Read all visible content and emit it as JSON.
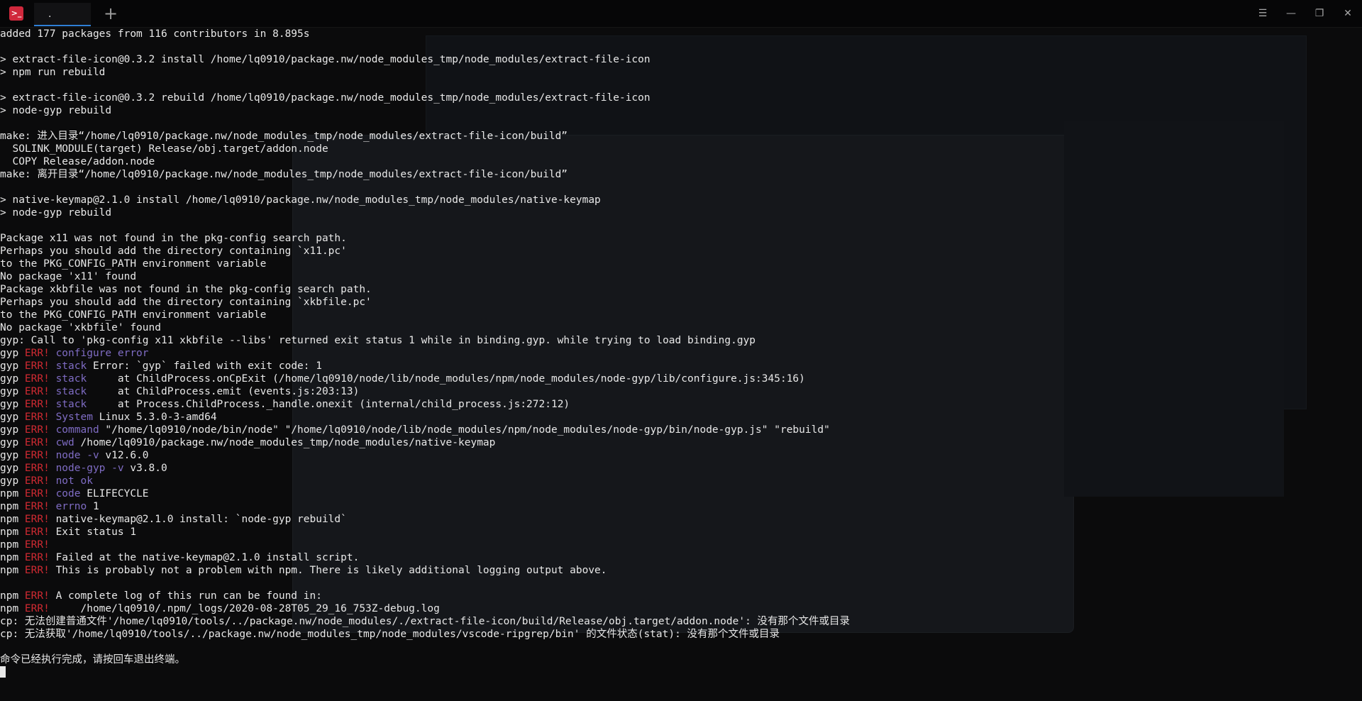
{
  "app": {
    "tab_title": ".",
    "new_tab_symbol": "+",
    "icon_name": "terminal-icon",
    "window_controls": [
      "menu-icon",
      "minimize-icon",
      "restore-icon",
      "close-icon"
    ],
    "window_control_glyphs": [
      "☰",
      "—",
      "❐",
      "✕"
    ]
  },
  "colors": {
    "background": "#0b0b0c",
    "text": "#e8e8e8",
    "err": "#d02a32",
    "keyword": "#7f6cc4",
    "tab_accent": "#2f7fd6",
    "app_icon": "#d0283c"
  },
  "terminal": {
    "lines": [
      {
        "t": "added 177 packages from 116 contributors in 8.895s"
      },
      {
        "t": ""
      },
      {
        "t": "> extract-file-icon@0.3.2 install /home/lq0910/package.nw/node_modules_tmp/node_modules/extract-file-icon"
      },
      {
        "t": "> npm run rebuild"
      },
      {
        "t": ""
      },
      {
        "t": "> extract-file-icon@0.3.2 rebuild /home/lq0910/package.nw/node_modules_tmp/node_modules/extract-file-icon"
      },
      {
        "t": "> node-gyp rebuild"
      },
      {
        "t": ""
      },
      {
        "t": "make: 进入目录“/home/lq0910/package.nw/node_modules_tmp/node_modules/extract-file-icon/build”"
      },
      {
        "t": "  SOLINK_MODULE(target) Release/obj.target/addon.node"
      },
      {
        "t": "  COPY Release/addon.node"
      },
      {
        "t": "make: 离开目录“/home/lq0910/package.nw/node_modules_tmp/node_modules/extract-file-icon/build”"
      },
      {
        "t": ""
      },
      {
        "t": "> native-keymap@2.1.0 install /home/lq0910/package.nw/node_modules_tmp/node_modules/native-keymap"
      },
      {
        "t": "> node-gyp rebuild"
      },
      {
        "t": ""
      },
      {
        "t": "Package x11 was not found in the pkg-config search path."
      },
      {
        "t": "Perhaps you should add the directory containing `x11.pc'"
      },
      {
        "t": "to the PKG_CONFIG_PATH environment variable"
      },
      {
        "t": "No package 'x11' found"
      },
      {
        "t": "Package xkbfile was not found in the pkg-config search path."
      },
      {
        "t": "Perhaps you should add the directory containing `xkbfile.pc'"
      },
      {
        "t": "to the PKG_CONFIG_PATH environment variable"
      },
      {
        "t": "No package 'xkbfile' found"
      },
      {
        "t": "gyp: Call to 'pkg-config x11 xkbfile --libs' returned exit status 1 while in binding.gyp. while trying to load binding.gyp"
      },
      {
        "p": "gyp ",
        "e": "ERR!",
        "k": " configure error",
        "r": ""
      },
      {
        "p": "gyp ",
        "e": "ERR!",
        "k": " stack",
        "r": " Error: `gyp` failed with exit code: 1"
      },
      {
        "p": "gyp ",
        "e": "ERR!",
        "k": " stack",
        "r": "     at ChildProcess.onCpExit (/home/lq0910/node/lib/node_modules/npm/node_modules/node-gyp/lib/configure.js:345:16)"
      },
      {
        "p": "gyp ",
        "e": "ERR!",
        "k": " stack",
        "r": "     at ChildProcess.emit (events.js:203:13)"
      },
      {
        "p": "gyp ",
        "e": "ERR!",
        "k": " stack",
        "r": "     at Process.ChildProcess._handle.onexit (internal/child_process.js:272:12)"
      },
      {
        "p": "gyp ",
        "e": "ERR!",
        "k": " System",
        "r": " Linux 5.3.0-3-amd64"
      },
      {
        "p": "gyp ",
        "e": "ERR!",
        "k": " command",
        "r": " \"/home/lq0910/node/bin/node\" \"/home/lq0910/node/lib/node_modules/npm/node_modules/node-gyp/bin/node-gyp.js\" \"rebuild\""
      },
      {
        "p": "gyp ",
        "e": "ERR!",
        "k": " cwd",
        "r": " /home/lq0910/package.nw/node_modules_tmp/node_modules/native-keymap"
      },
      {
        "p": "gyp ",
        "e": "ERR!",
        "k": " node -v",
        "r": " v12.6.0"
      },
      {
        "p": "gyp ",
        "e": "ERR!",
        "k": " node-gyp -v",
        "r": " v3.8.0"
      },
      {
        "p": "gyp ",
        "e": "ERR!",
        "k": " not ok",
        "r": ""
      },
      {
        "p": "npm ",
        "e": "ERR!",
        "k": " code",
        "r": " ELIFECYCLE"
      },
      {
        "p": "npm ",
        "e": "ERR!",
        "k": " errno",
        "r": " 1"
      },
      {
        "p": "npm ",
        "e": "ERR!",
        "k": "",
        "r": " native-keymap@2.1.0 install: `node-gyp rebuild`"
      },
      {
        "p": "npm ",
        "e": "ERR!",
        "k": "",
        "r": " Exit status 1"
      },
      {
        "p": "npm ",
        "e": "ERR!",
        "k": "",
        "r": ""
      },
      {
        "p": "npm ",
        "e": "ERR!",
        "k": "",
        "r": " Failed at the native-keymap@2.1.0 install script."
      },
      {
        "p": "npm ",
        "e": "ERR!",
        "k": "",
        "r": " This is probably not a problem with npm. There is likely additional logging output above."
      },
      {
        "t": ""
      },
      {
        "p": "npm ",
        "e": "ERR!",
        "k": "",
        "r": " A complete log of this run can be found in:"
      },
      {
        "p": "npm ",
        "e": "ERR!",
        "k": "",
        "r": "     /home/lq0910/.npm/_logs/2020-08-28T05_29_16_753Z-debug.log"
      },
      {
        "t": "cp: 无法创建普通文件'/home/lq0910/tools/../package.nw/node_modules/./extract-file-icon/build/Release/obj.target/addon.node': 没有那个文件或目录"
      },
      {
        "t": "cp: 无法获取'/home/lq0910/tools/../package.nw/node_modules_tmp/node_modules/vscode-ripgrep/bin' 的文件状态(stat): 没有那个文件或目录"
      },
      {
        "t": ""
      },
      {
        "t": "命令已经执行完成，请按回车退出终端。"
      }
    ]
  }
}
